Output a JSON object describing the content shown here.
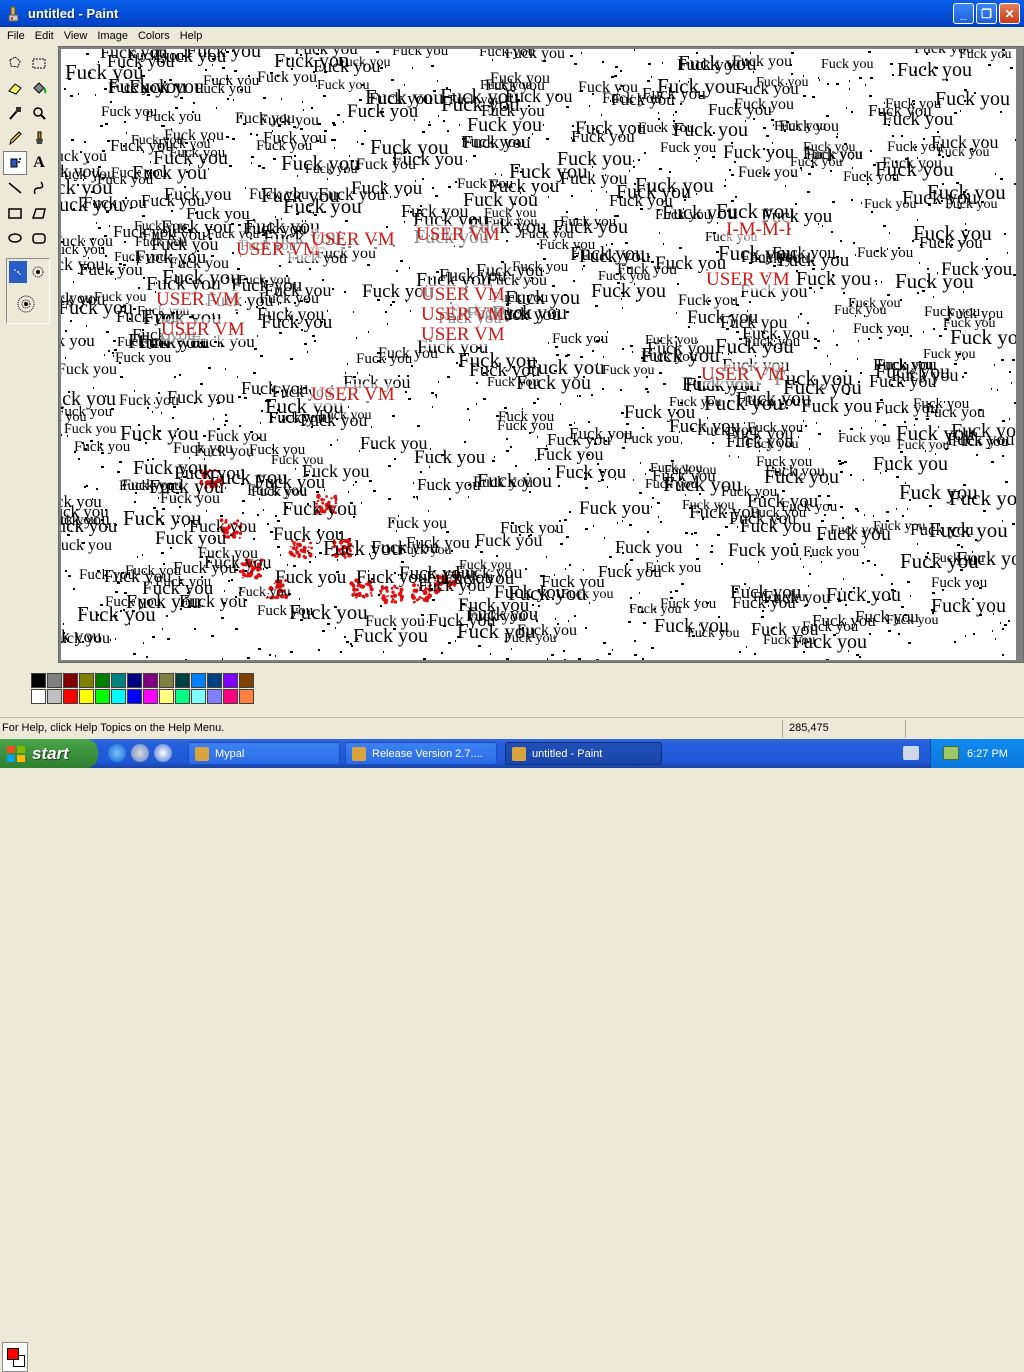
{
  "window": {
    "title": "untitled - Paint",
    "minimize": "_",
    "maximize": "❐",
    "close": "✕"
  },
  "menu": [
    "File",
    "Edit",
    "View",
    "Image",
    "Colors",
    "Help"
  ],
  "tools": [
    {
      "name": "free-form-select-icon"
    },
    {
      "name": "select-icon"
    },
    {
      "name": "eraser-icon"
    },
    {
      "name": "fill-icon"
    },
    {
      "name": "pick-color-icon"
    },
    {
      "name": "magnifier-icon"
    },
    {
      "name": "pencil-icon"
    },
    {
      "name": "brush-icon"
    },
    {
      "name": "airbrush-icon"
    },
    {
      "name": "text-icon"
    },
    {
      "name": "line-icon"
    },
    {
      "name": "curve-icon"
    },
    {
      "name": "rectangle-icon"
    },
    {
      "name": "polygon-icon"
    },
    {
      "name": "ellipse-icon"
    },
    {
      "name": "rounded-rectangle-icon"
    }
  ],
  "canvas": {
    "repeated_text": "Fuck you",
    "red_labels": [
      "USER VM",
      "USER VM",
      "USER VM",
      "USER VM",
      "USER VM",
      "USER VM",
      "USER VM",
      "USER VM",
      "USER VM",
      "USER VM",
      "USER VM"
    ],
    "red_mm": "I-M-M-I"
  },
  "palette": {
    "foreground": "#FF0000",
    "background": "#FFFFFF",
    "row1": [
      "#000000",
      "#808080",
      "#800000",
      "#808000",
      "#008000",
      "#008080",
      "#000080",
      "#800080",
      "#808040",
      "#004040",
      "#0080FF",
      "#004080",
      "#8000FF",
      "#804000"
    ],
    "row2": [
      "#FFFFFF",
      "#C0C0C0",
      "#FF0000",
      "#FFFF00",
      "#00FF00",
      "#00FFFF",
      "#0000FF",
      "#FF00FF",
      "#FFFF80",
      "#00FF80",
      "#80FFFF",
      "#8080FF",
      "#FF0080",
      "#FF8040"
    ]
  },
  "status": {
    "help": "For Help, click Help Topics on the Help Menu.",
    "coords": "285,475"
  },
  "taskbar": {
    "start": "start",
    "tasks": [
      {
        "label": "Mypal",
        "active": false
      },
      {
        "label": "Release Version 2.7....",
        "active": false
      },
      {
        "label": "untitled - Paint",
        "active": true
      }
    ],
    "clock": "6:27 PM"
  }
}
